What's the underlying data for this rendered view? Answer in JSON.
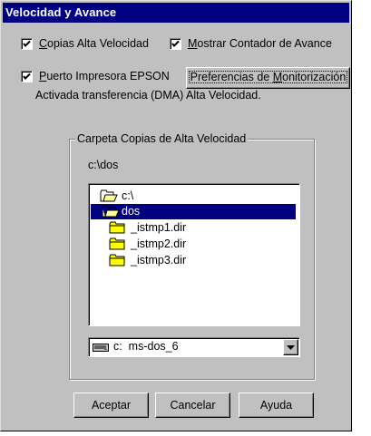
{
  "window": {
    "title": "Velocidad y Avance"
  },
  "options": {
    "copias_label": "Copias Alta Velocidad",
    "copias_checked": true,
    "mostrar_label": "Mostrar Contador de Avance",
    "mostrar_checked": true,
    "puerto_label": "Puerto Impresora EPSON",
    "puerto_checked": true,
    "preferencias_button": "Preferencias de Monitorización",
    "dma_text": "Activada transferencia (DMA) Alta Velocidad."
  },
  "folder_group": {
    "label": "Carpeta Copias de Alta Velocidad",
    "current_path": "c:\\dos",
    "items": [
      {
        "label": "c:\\",
        "icon": "open-folder-icon",
        "selected": false
      },
      {
        "label": "dos",
        "icon": "open-folder-icon",
        "selected": true
      },
      {
        "label": "_istmp1.dir",
        "icon": "folder-icon",
        "selected": false
      },
      {
        "label": "_istmp2.dir",
        "icon": "folder-icon",
        "selected": false
      },
      {
        "label": "_istmp3.dir",
        "icon": "folder-icon",
        "selected": false
      }
    ],
    "drive_value": "c:  ms-dos_6",
    "drive_icon": "drive-icon"
  },
  "buttons": {
    "accept": "Aceptar",
    "cancel": "Cancelar",
    "help": "Ayuda"
  },
  "colors": {
    "title_bar": "#000080",
    "selection": "#000080",
    "face": "#c0c0c0",
    "folder": "#ffff00"
  }
}
